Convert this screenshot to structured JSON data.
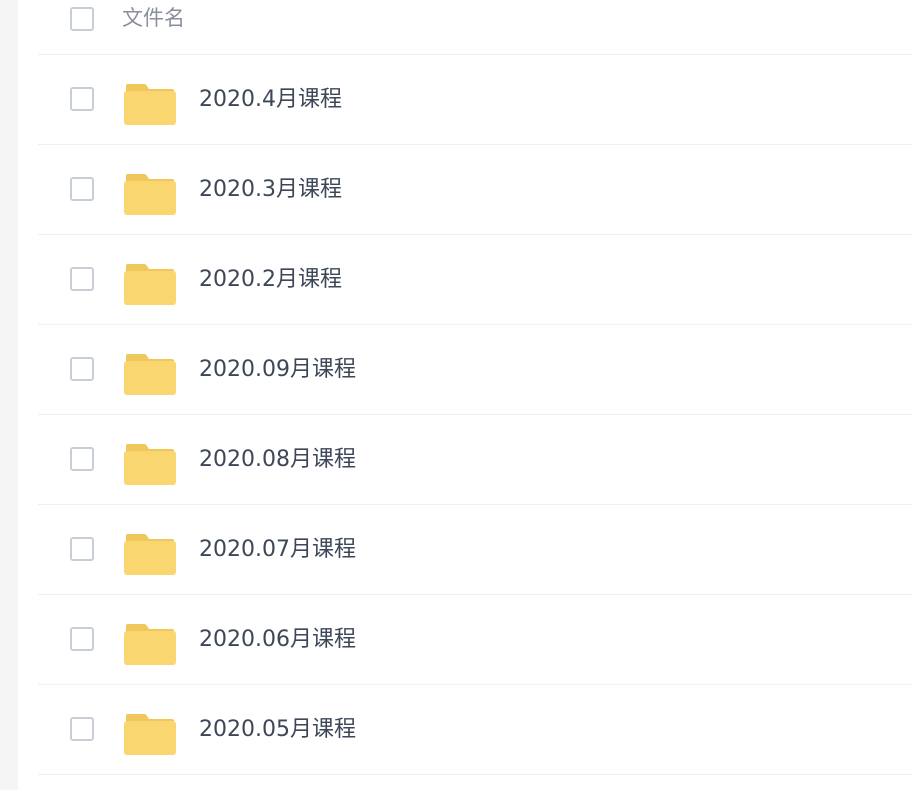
{
  "header": {
    "column_label": "文件名"
  },
  "colors": {
    "folder": "#f9d66f",
    "folder_tab": "#f0c75a",
    "text": "#3d4757",
    "header_text": "#8a8f99",
    "divider": "#eef0f4"
  },
  "files": [
    {
      "name": "2020.4月课程",
      "icon": "folder-icon"
    },
    {
      "name": "2020.3月课程",
      "icon": "folder-icon"
    },
    {
      "name": "2020.2月课程",
      "icon": "folder-icon"
    },
    {
      "name": "2020.09月课程",
      "icon": "folder-icon"
    },
    {
      "name": "2020.08月课程",
      "icon": "folder-icon"
    },
    {
      "name": "2020.07月课程",
      "icon": "folder-icon"
    },
    {
      "name": "2020.06月课程",
      "icon": "folder-icon"
    },
    {
      "name": "2020.05月课程",
      "icon": "folder-icon"
    }
  ]
}
